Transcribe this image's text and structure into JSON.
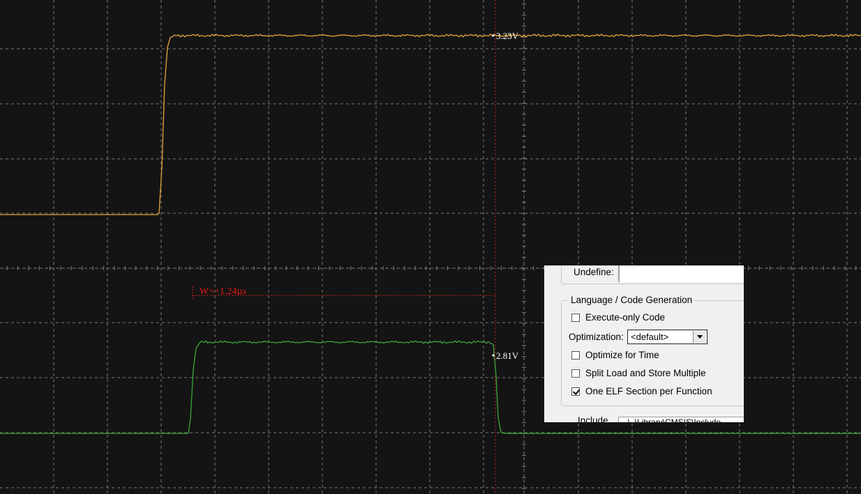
{
  "scope": {
    "background": "#141414",
    "grid_color": "#7a7a7a",
    "channel1": {
      "color": "#e8a838",
      "label": "3.23V"
    },
    "channel2": {
      "color": "#3aa83a",
      "label": "2.81V"
    },
    "cursor": {
      "color": "#d22020"
    },
    "measurement": {
      "color": "#e01818",
      "label": "W=+1.24µs"
    }
  },
  "dialog": {
    "undefine_label": "Undefine:",
    "group_title": "Language / Code Generation",
    "execute_only": {
      "label": "Execute-only Code",
      "checked": false
    },
    "optimization_label": "Optimization:",
    "optimization_value": "<default>",
    "optimize_time": {
      "label": "Optimize for Time",
      "checked": false
    },
    "split_load": {
      "label": "Split Load and Store Multiple",
      "checked": false
    },
    "one_elf": {
      "label": "One ELF Section per Function",
      "checked": true
    },
    "include_label": "Include",
    "include_value": "..\\..\\Library\\CMSIS\\Include"
  }
}
